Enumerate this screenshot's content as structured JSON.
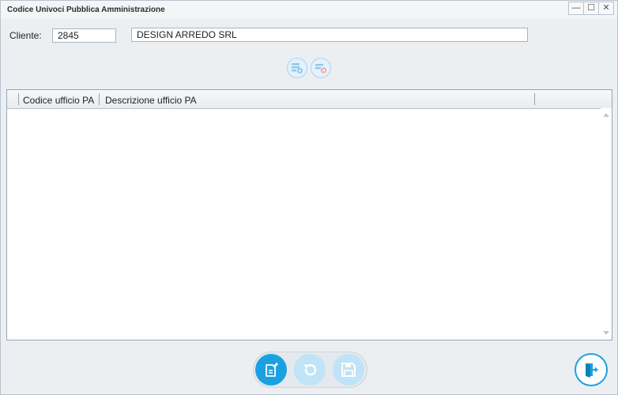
{
  "window": {
    "title": "Codice Univoci Pubblica Amministrazione",
    "controls": {
      "minimize": "—",
      "maximize": "☐",
      "close": "✕"
    }
  },
  "form": {
    "cliente_label": "Cliente:",
    "cliente_code": "2845",
    "cliente_name": "DESIGN ARREDO SRL"
  },
  "grid": {
    "columns": [
      "Codice ufficio PA",
      "Descrizione ufficio PA"
    ],
    "rows": []
  },
  "icons": {
    "add_row": "add-row-icon",
    "delete_row": "delete-row-icon",
    "edit": "edit-icon",
    "undo": "undo-icon",
    "save": "save-icon",
    "exit": "exit-icon"
  },
  "colors": {
    "accent": "#1ba1e2",
    "accent_disabled": "#bfe3f7",
    "window_bg": "#eceff2"
  }
}
